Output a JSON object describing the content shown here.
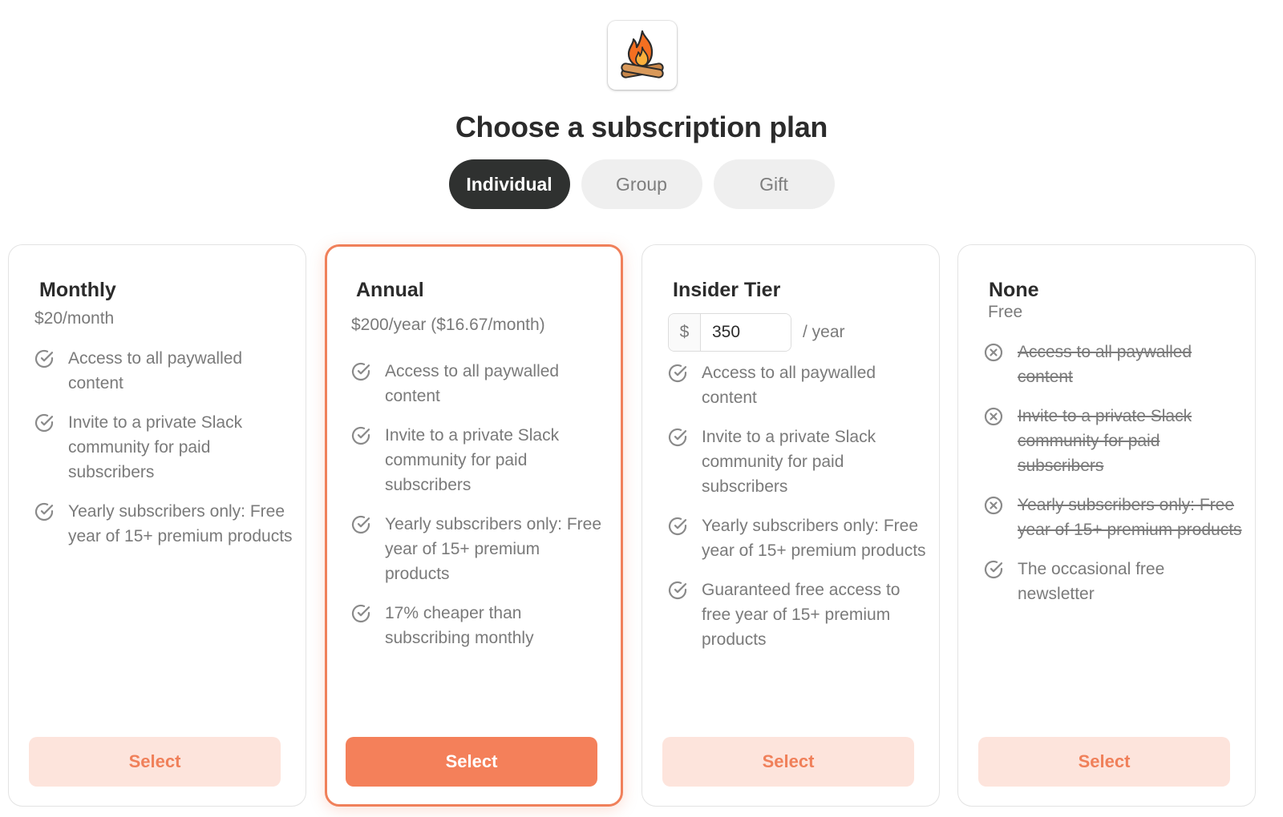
{
  "page": {
    "title": "Choose a subscription plan"
  },
  "tabs": [
    {
      "label": "Individual",
      "active": true
    },
    {
      "label": "Group",
      "active": false
    },
    {
      "label": "Gift",
      "active": false
    }
  ],
  "colors": {
    "accent": "#f4805a",
    "accent_light": "#fde4dc",
    "dark": "#2f3130",
    "muted_text": "#7a7a7a"
  },
  "plans": [
    {
      "name": "Monthly",
      "price": "$20/month",
      "features": [
        {
          "text": "Access to all paywalled content",
          "included": true
        },
        {
          "text": "Invite to a private Slack community for paid subscribers",
          "included": true
        },
        {
          "text": "Yearly subscribers only: Free year of 15+ premium products",
          "included": true
        }
      ],
      "button": "Select"
    },
    {
      "name": "Annual",
      "price": "$200/year ($16.67/month)",
      "features": [
        {
          "text": "Access to all paywalled content",
          "included": true
        },
        {
          "text": "Invite to a private Slack community for paid subscribers",
          "included": true
        },
        {
          "text": "Yearly subscribers only: Free year of 15+ premium products",
          "included": true
        },
        {
          "text": "17% cheaper than subscribing monthly",
          "included": true
        }
      ],
      "button": "Select"
    },
    {
      "name": "Insider Tier",
      "currency_symbol": "$",
      "price_value": "350",
      "price_suffix": "/ year",
      "features": [
        {
          "text": "Access to all paywalled content",
          "included": true
        },
        {
          "text": "Invite to a private Slack community for paid subscribers",
          "included": true
        },
        {
          "text": "Yearly subscribers only: Free year of 15+ premium products",
          "included": true
        },
        {
          "text": "Guaranteed free access to free year of 15+ premium products",
          "included": true
        }
      ],
      "button": "Select"
    },
    {
      "name": "None",
      "price": "Free",
      "features": [
        {
          "text": "Access to all paywalled content",
          "included": false
        },
        {
          "text": "Invite to a private Slack community for paid subscribers",
          "included": false
        },
        {
          "text": "Yearly subscribers only: Free year of 15+ premium products",
          "included": false
        },
        {
          "text": "The occasional free newsletter",
          "included": true
        }
      ],
      "button": "Select"
    }
  ]
}
